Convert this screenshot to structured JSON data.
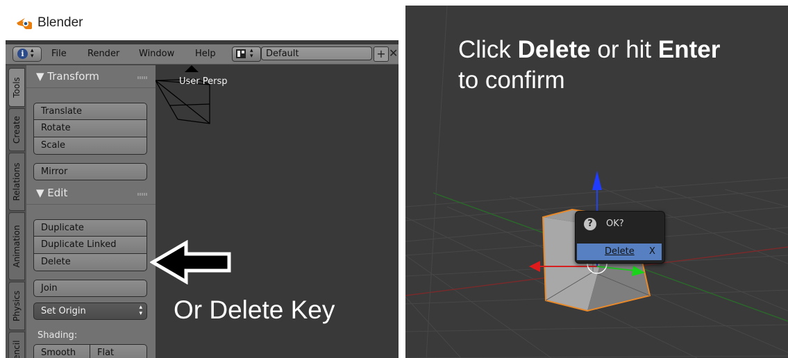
{
  "left_panel": {
    "app_title": "Blender",
    "menu": {
      "file": "File",
      "render": "Render",
      "window": "Window",
      "help": "Help",
      "layout_value": "Default"
    },
    "tabs": [
      "Tools",
      "Create",
      "Relations",
      "Animation",
      "Physics",
      "Pencil"
    ],
    "transform": {
      "header": "▼ Transform",
      "translate": "Translate",
      "rotate": "Rotate",
      "scale": "Scale",
      "mirror": "Mirror"
    },
    "edit": {
      "header": "▼ Edit",
      "duplicate": "Duplicate",
      "duplicate_linked": "Duplicate Linked",
      "delete": "Delete",
      "join": "Join",
      "set_origin": "Set Origin"
    },
    "shading": {
      "label": "Shading:",
      "smooth": "Smooth",
      "flat": "Flat"
    },
    "viewport_label": "User Persp",
    "annotation": "Or Delete Key"
  },
  "right_panel": {
    "instruction_line1_pre": "Click ",
    "instruction_line1_bold1": "Delete",
    "instruction_line1_mid": " or hit ",
    "instruction_line1_bold2": "Enter",
    "instruction_line2": "to confirm",
    "dialog": {
      "title": "OK?",
      "delete_label": "Delete",
      "shortcut": "X"
    }
  },
  "colors": {
    "selection_outline": "#e8892a",
    "menu_highlight": "#5680c2",
    "x_axis": "#d81f1f",
    "y_axis": "#22c222",
    "z_axis": "#2244ee"
  }
}
